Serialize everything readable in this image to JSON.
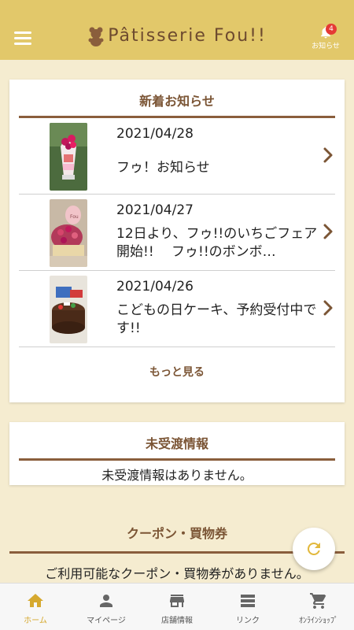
{
  "header": {
    "brand": "Pâtisserie Fou!!",
    "notification_label": "お知らせ",
    "notification_count": "4"
  },
  "news": {
    "title": "新着お知らせ",
    "items": [
      {
        "date": "2021/04/28",
        "title": "フゥ！お知らせ"
      },
      {
        "date": "2021/04/27",
        "title": "12日より、フゥ!!のいちごフェア開始!!　 フゥ!!のボンボ…"
      },
      {
        "date": "2021/04/26",
        "title": "こどもの日ケーキ、予約受付中です!!"
      }
    ],
    "more_label": "もっと見る"
  },
  "undelivered": {
    "title": "未受渡情報",
    "message": "未受渡情報はありません。"
  },
  "coupon": {
    "title": "クーポン・買物券",
    "message": "ご利用可能なクーポン・買物券がありません。"
  },
  "tabs": [
    {
      "label": "ホーム",
      "icon": "home-icon",
      "active": true
    },
    {
      "label": "マイページ",
      "icon": "person-icon",
      "active": false
    },
    {
      "label": "店舗情報",
      "icon": "store-icon",
      "active": false
    },
    {
      "label": "リンク",
      "icon": "list-icon",
      "active": false
    },
    {
      "label": "ｵﾝﾗｲﾝｼｮｯﾌﾟ",
      "icon": "cart-icon",
      "active": false
    }
  ],
  "colors": {
    "header": "#e2c86a",
    "accent_brown": "#7b5535",
    "tab_active": "#d6a92f",
    "badge": "#e53935",
    "background": "#f5ecd0"
  }
}
